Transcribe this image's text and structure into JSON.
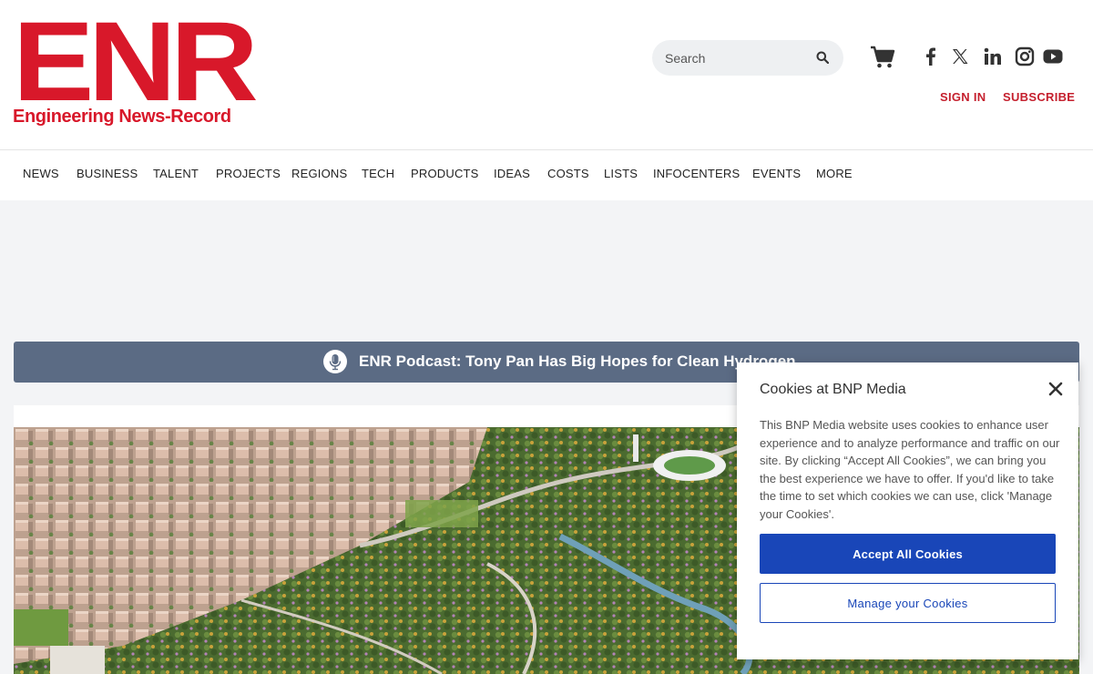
{
  "logo": {
    "main": "ENR",
    "sub": "Engineering News-Record",
    "color": "#d8182a"
  },
  "search": {
    "placeholder": "Search"
  },
  "header_links": {
    "sign_in": "SIGN IN",
    "subscribe": "SUBSCRIBE"
  },
  "nav": {
    "items": [
      "NEWS",
      "BUSINESS",
      "TALENT",
      "PROJECTS",
      "REGIONS",
      "TECH",
      "PRODUCTS",
      "IDEAS",
      "COSTS",
      "LISTS",
      "INFOCENTERS",
      "EVENTS",
      "MORE"
    ]
  },
  "podcast": {
    "title": "ENR Podcast: Tony Pan Has Big Hopes for Clean Hydrogen"
  },
  "cookie": {
    "title": "Cookies at BNP Media",
    "body": "This BNP Media website uses cookies to enhance user experience and to analyze performance and traffic on our site. By clicking “Accept All Cookies”, we can bring you the best experience we have to offer. If you'd like to take the time to set which cookies we can use, click 'Manage your Cookies'.",
    "accept_label": "Accept All Cookies",
    "manage_label": "Manage your Cookies",
    "accent": "#1946b8"
  },
  "icons": [
    "search-icon",
    "cart-icon",
    "facebook-icon",
    "x-icon",
    "linkedin-icon",
    "instagram-icon",
    "youtube-icon",
    "microphone-icon",
    "close-icon"
  ]
}
